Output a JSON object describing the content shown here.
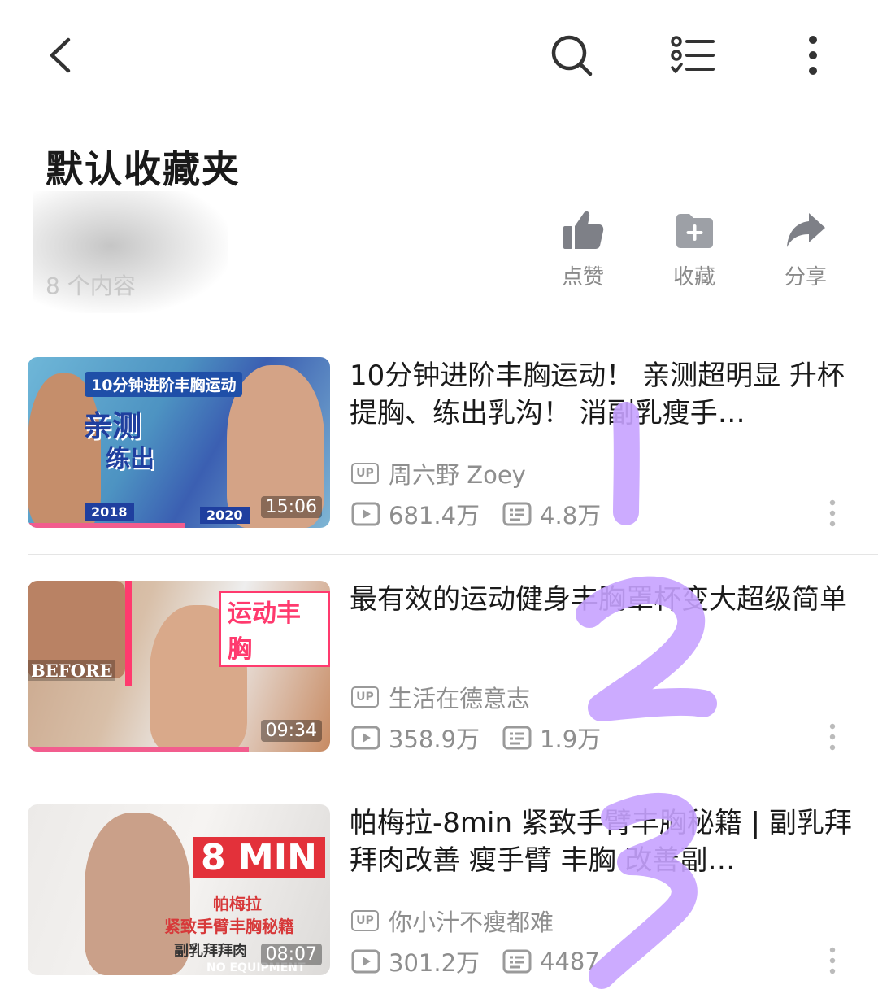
{
  "header": {
    "back_icon": "chevron-left-icon",
    "search_icon": "search-icon",
    "list_icon": "checklist-icon",
    "more_icon": "more-vertical-icon"
  },
  "folder": {
    "title": "默认收藏夹",
    "count_text": "8 个内容"
  },
  "actions": [
    {
      "icon": "thumbs-up-icon",
      "label": "点赞"
    },
    {
      "icon": "folder-add-icon",
      "label": "收藏"
    },
    {
      "icon": "share-icon",
      "label": "分享"
    }
  ],
  "videos": [
    {
      "title": "10分钟进阶丰胸运动！ 亲测超明显 升杯提胸、练出乳沟！ 消副乳瘦手…",
      "uploader": "周六野 Zoey",
      "up_badge": "UP",
      "views": "681.4万",
      "danmaku": "4.8万",
      "duration": "15:06",
      "thumb_text": {
        "tag": "10分钟进阶丰胸运动",
        "big": "亲测",
        "small": "练出",
        "year1": "2018",
        "year2": "2020"
      },
      "progress": 0.52
    },
    {
      "title": "最有效的运动健身丰胸罩杯变大超级简单",
      "uploader": "生活在德意志",
      "up_badge": "UP",
      "views": "358.9万",
      "danmaku": "1.9万",
      "duration": "09:34",
      "thumb_text": {
        "before": "BEFORE",
        "tag": "运动丰胸"
      },
      "progress": 0.73
    },
    {
      "title": "帕梅拉-8min 紧致手臂丰胸秘籍 | 副乳拜拜肉改善 瘦手臂 丰胸 改善副…",
      "uploader": "你小汁不瘦都难",
      "up_badge": "UP",
      "views": "301.2万",
      "danmaku": "4487",
      "duration": "08:07",
      "thumb_text": {
        "tag": "8 MIN",
        "sub1": "帕梅拉",
        "sub2": "紧致手臂丰胸秘籍",
        "sub3": "副乳拜拜肉",
        "foot": "NO EQUIPMENT"
      },
      "progress": 0
    }
  ],
  "colors": {
    "accent_pink": "#f25d8e",
    "text_primary": "#1a1a1a",
    "text_secondary": "#8e8e8e",
    "annotation_purple": "#c6a2ff"
  },
  "annotations": [
    "1",
    "2",
    "3"
  ]
}
